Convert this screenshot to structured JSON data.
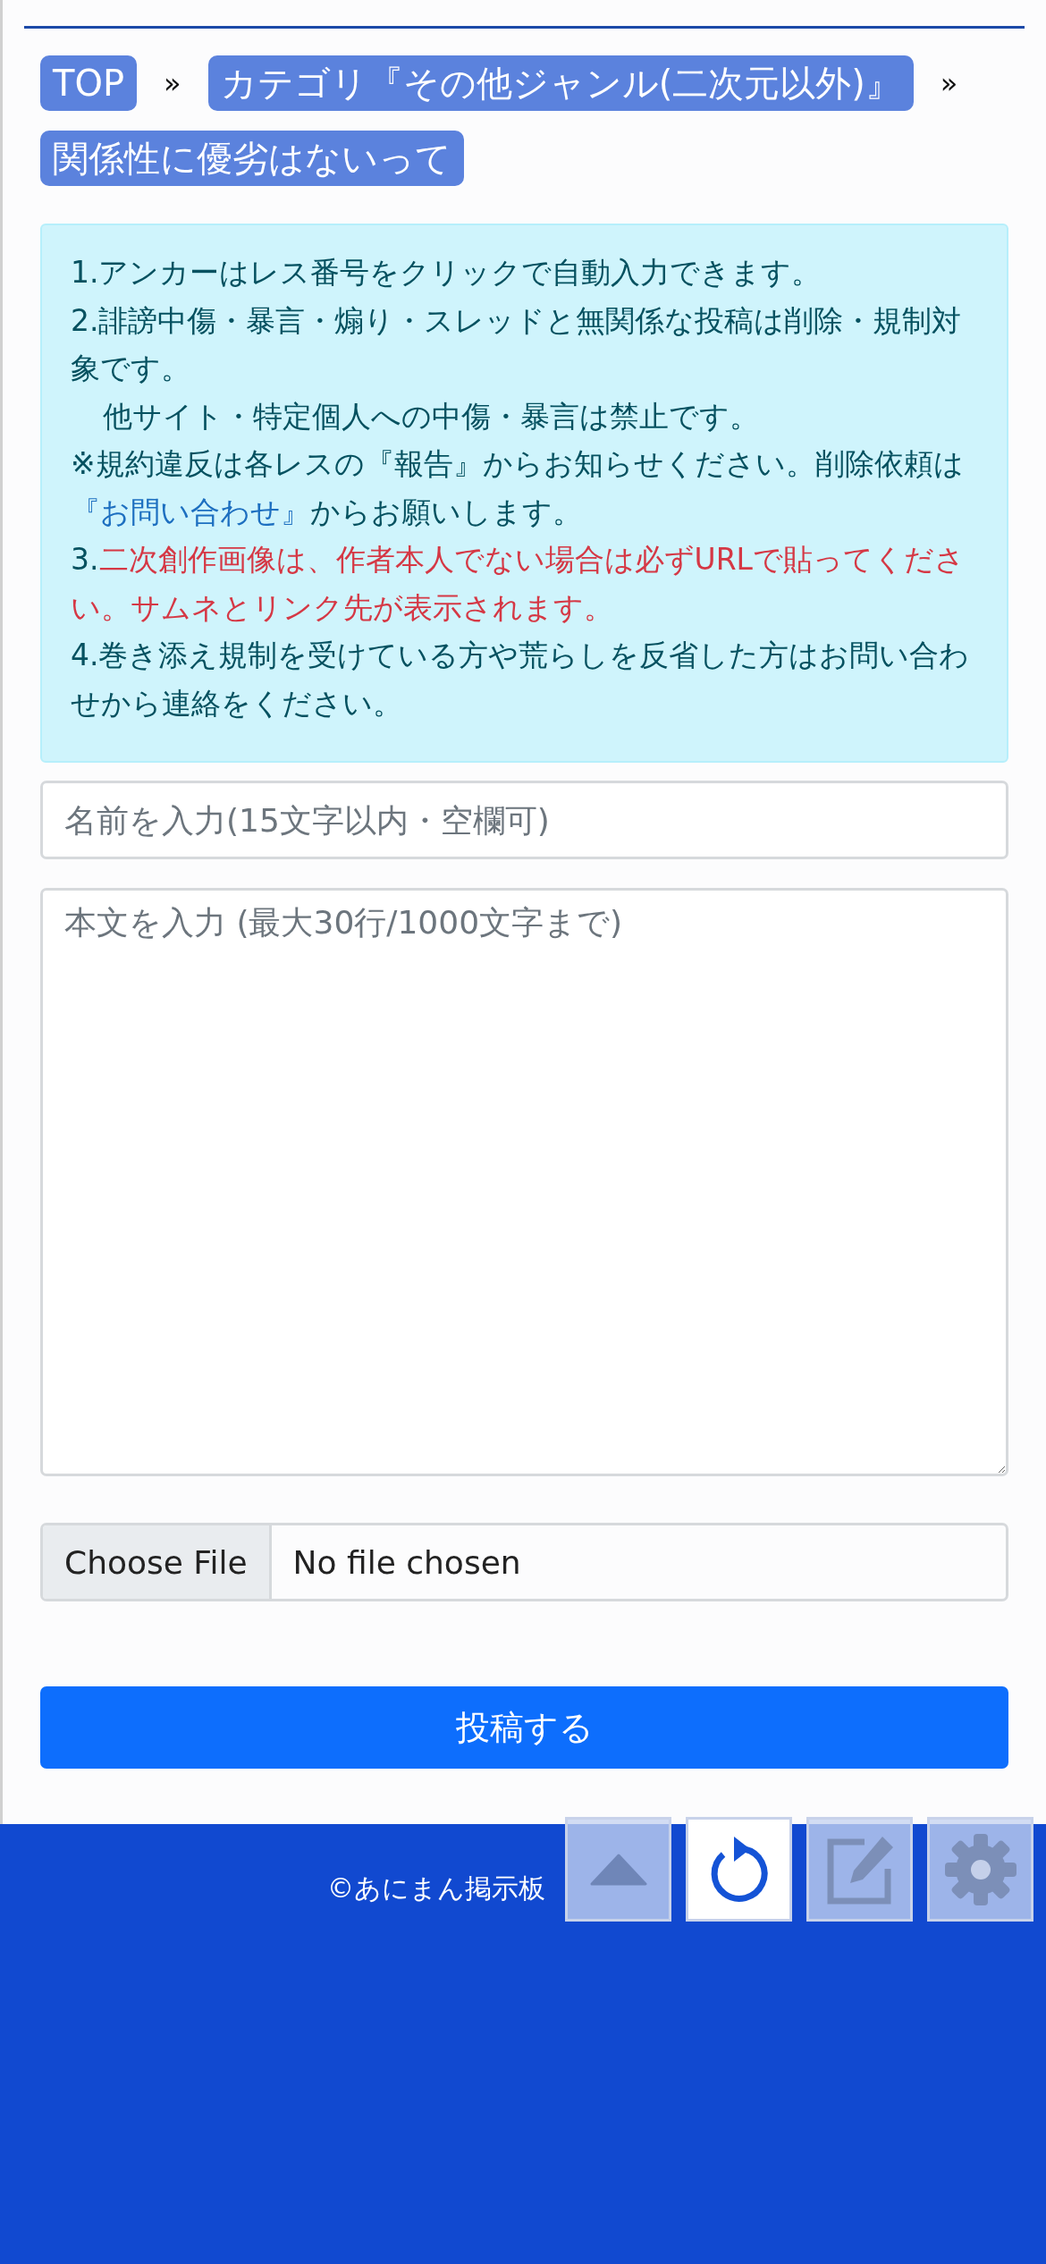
{
  "breadcrumbs": [
    {
      "label": "TOP"
    },
    {
      "label": "カテゴリ『その他ジャンル(二次元以外)』"
    },
    {
      "label": "関係性に優劣はないって"
    }
  ],
  "breadcrumb_separator": "»",
  "notice": [
    {
      "indent": false,
      "segments": [
        {
          "kind": "text",
          "text": "1.アンカーはレス番号をクリックで自動入力できます。"
        }
      ]
    },
    {
      "indent": false,
      "segments": [
        {
          "kind": "text",
          "text": "2.誹謗中傷・暴言・煽り・スレッドと無関係な投稿は削除・規制対象です。"
        }
      ]
    },
    {
      "indent": true,
      "segments": [
        {
          "kind": "text",
          "text": "他サイト・特定個人への中傷・暴言は禁止です。"
        }
      ]
    },
    {
      "indent": false,
      "segments": [
        {
          "kind": "text",
          "text": "※規約違反は各レスの『報告』からお知らせください。削除依頼は"
        },
        {
          "kind": "link",
          "text": "『お問い合わせ』"
        },
        {
          "kind": "text",
          "text": "からお願いします。"
        }
      ]
    },
    {
      "indent": false,
      "segments": [
        {
          "kind": "text",
          "text": "3."
        },
        {
          "kind": "warning",
          "text": "二次創作画像は、作者本人でない場合は必ずURLで貼ってください。サムネとリンク先が表示されます。"
        }
      ]
    },
    {
      "indent": false,
      "segments": [
        {
          "kind": "text",
          "text": "4.巻き添え規制を受けている方や荒らしを反省した方はお問い合わせから連絡をください。"
        }
      ]
    }
  ],
  "name_field": {
    "placeholder": "名前を入力(15文字以内・空欄可)"
  },
  "body_field": {
    "placeholder": "本文を入力 (最大30行/1000文字まで)"
  },
  "file_input": {
    "button": "Choose File",
    "status": "No file chosen"
  },
  "submit_button": "投稿する",
  "footer": {
    "copyright": "©あにまん掲示板"
  },
  "floating_buttons": [
    {
      "kind": "up",
      "disabled": true
    },
    {
      "kind": "reload",
      "disabled": false
    },
    {
      "kind": "edit",
      "disabled": true
    },
    {
      "kind": "settings",
      "disabled": true
    }
  ]
}
